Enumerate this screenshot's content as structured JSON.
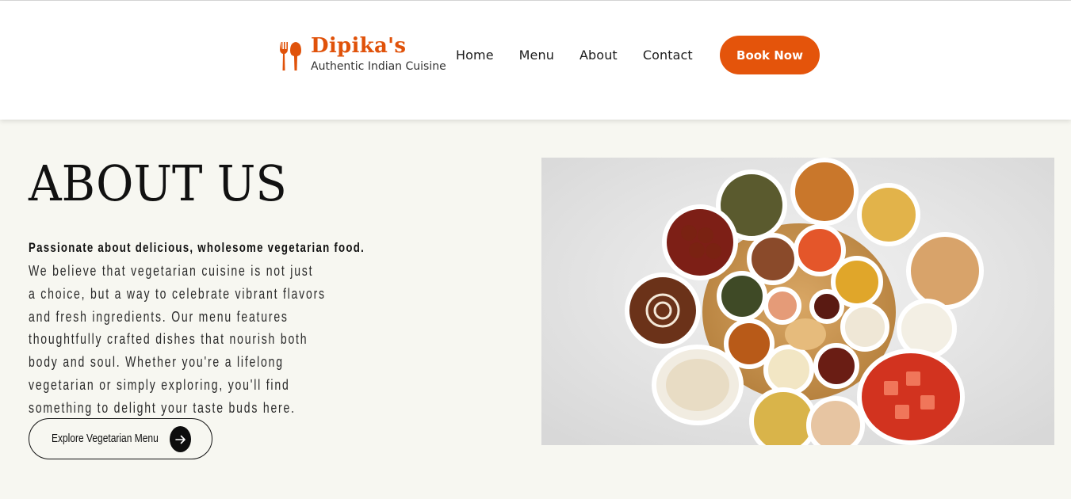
{
  "header": {
    "brand": {
      "name": "Dipika's",
      "tagline": "Authentic Indian Cuisine",
      "icon": "fork-spoon-icon"
    },
    "nav": [
      {
        "label": "Home"
      },
      {
        "label": "Menu"
      },
      {
        "label": "About"
      },
      {
        "label": "Contact"
      }
    ],
    "cta_label": "Book Now"
  },
  "about": {
    "title": "ABOUT US",
    "lead": "Passionate about delicious, wholesome vegetarian food.",
    "body_lines": [
      "We believe that vegetarian cuisine is not just",
      "a choice, but a way to celebrate vibrant flavors",
      "and fresh ingredients. Our menu features",
      "thoughtfully crafted dishes that nourish both",
      "body and soul. Whether you're a lifelong",
      "vegetarian or simply exploring, you'll find",
      "something to delight your taste buds here."
    ],
    "cta_label": "Explore Vegetarian Menu",
    "cta_icon": "arrow-right-icon",
    "image_alt": "vegetarian-thali-platter"
  },
  "colors": {
    "brand": "#e0520a",
    "button": "#e4540b",
    "page_background": "#f7f7f1",
    "header_background": "#ffffff",
    "text": "#111111"
  }
}
